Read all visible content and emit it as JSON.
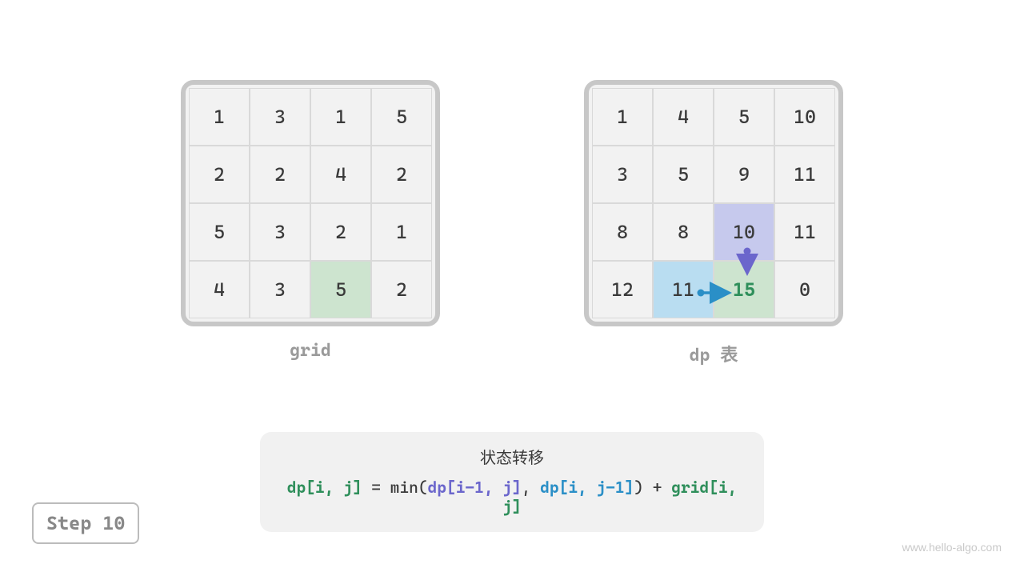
{
  "grid": {
    "label": "grid",
    "cells": [
      [
        1,
        3,
        1,
        5
      ],
      [
        2,
        2,
        4,
        2
      ],
      [
        5,
        3,
        2,
        1
      ],
      [
        4,
        3,
        5,
        2
      ]
    ],
    "highlight": {
      "r": 3,
      "c": 2,
      "class": "hl-green"
    }
  },
  "dp": {
    "label": "dp 表",
    "cells": [
      [
        1,
        4,
        5,
        10
      ],
      [
        3,
        5,
        9,
        11
      ],
      [
        8,
        8,
        10,
        11
      ],
      [
        12,
        11,
        15,
        0
      ]
    ],
    "highlights": [
      {
        "r": 2,
        "c": 2,
        "class": "hl-purple"
      },
      {
        "r": 3,
        "c": 1,
        "class": "hl-blue"
      },
      {
        "r": 3,
        "c": 2,
        "class": "hl-green current"
      }
    ]
  },
  "formula": {
    "title": "状态转移",
    "lhs": "dp[i, j]",
    "eq": " = min(",
    "arg1": "dp[i-1, j]",
    "sep1": ", ",
    "arg2": "dp[i, j-1]",
    "close": ") + ",
    "rhs": "grid[i, j]"
  },
  "step": "Step 10",
  "watermark": "www.hello-algo.com",
  "colors": {
    "green": "#2f8f5b",
    "purple": "#6b66cc",
    "blue": "#2a8fc7"
  }
}
